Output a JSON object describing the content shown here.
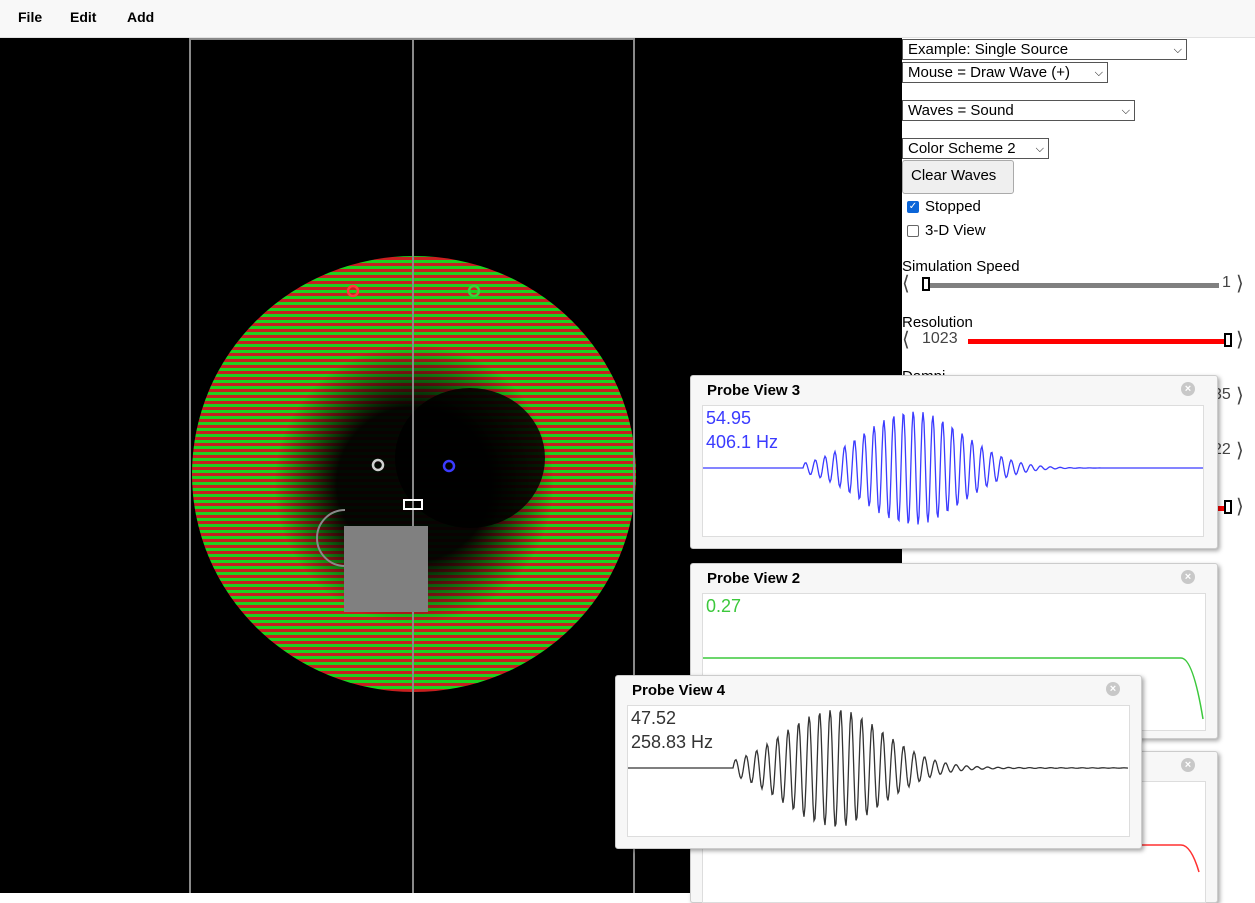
{
  "menu": [
    "File",
    "Edit",
    "Add"
  ],
  "controls": {
    "example_select": "Example: Single Source",
    "mouse_select": "Mouse = Draw Wave (+)",
    "waves_select": "Waves = Sound",
    "color_select": "Color Scheme 2",
    "clear_button": "Clear Waves",
    "stopped_label": "Stopped",
    "stopped_checked": true,
    "view3d_label": "3-D View",
    "view3d_checked": false
  },
  "sliders": {
    "speed_label": "Simulation Speed",
    "speed_value": "1",
    "resolution_label": "Resolution",
    "resolution_value": "1023",
    "damping_label": "Dampi",
    "hidden_value_1": "35",
    "hidden_value_2": "22"
  },
  "probes": {
    "p3": {
      "title": "Probe View 3",
      "value": "54.95",
      "freq": "406.1 Hz",
      "color": "#3b3bff"
    },
    "p2": {
      "title": "Probe View 2",
      "value": "0.27",
      "color": "#3cc83c"
    },
    "p4": {
      "title": "Probe View 4",
      "value": "47.52",
      "freq": "258.83 Hz",
      "color": "#333333"
    },
    "p1": {
      "color": "#ff3030"
    }
  },
  "icons": {
    "close": "close-icon",
    "checkbox": "checkbox-icon"
  }
}
